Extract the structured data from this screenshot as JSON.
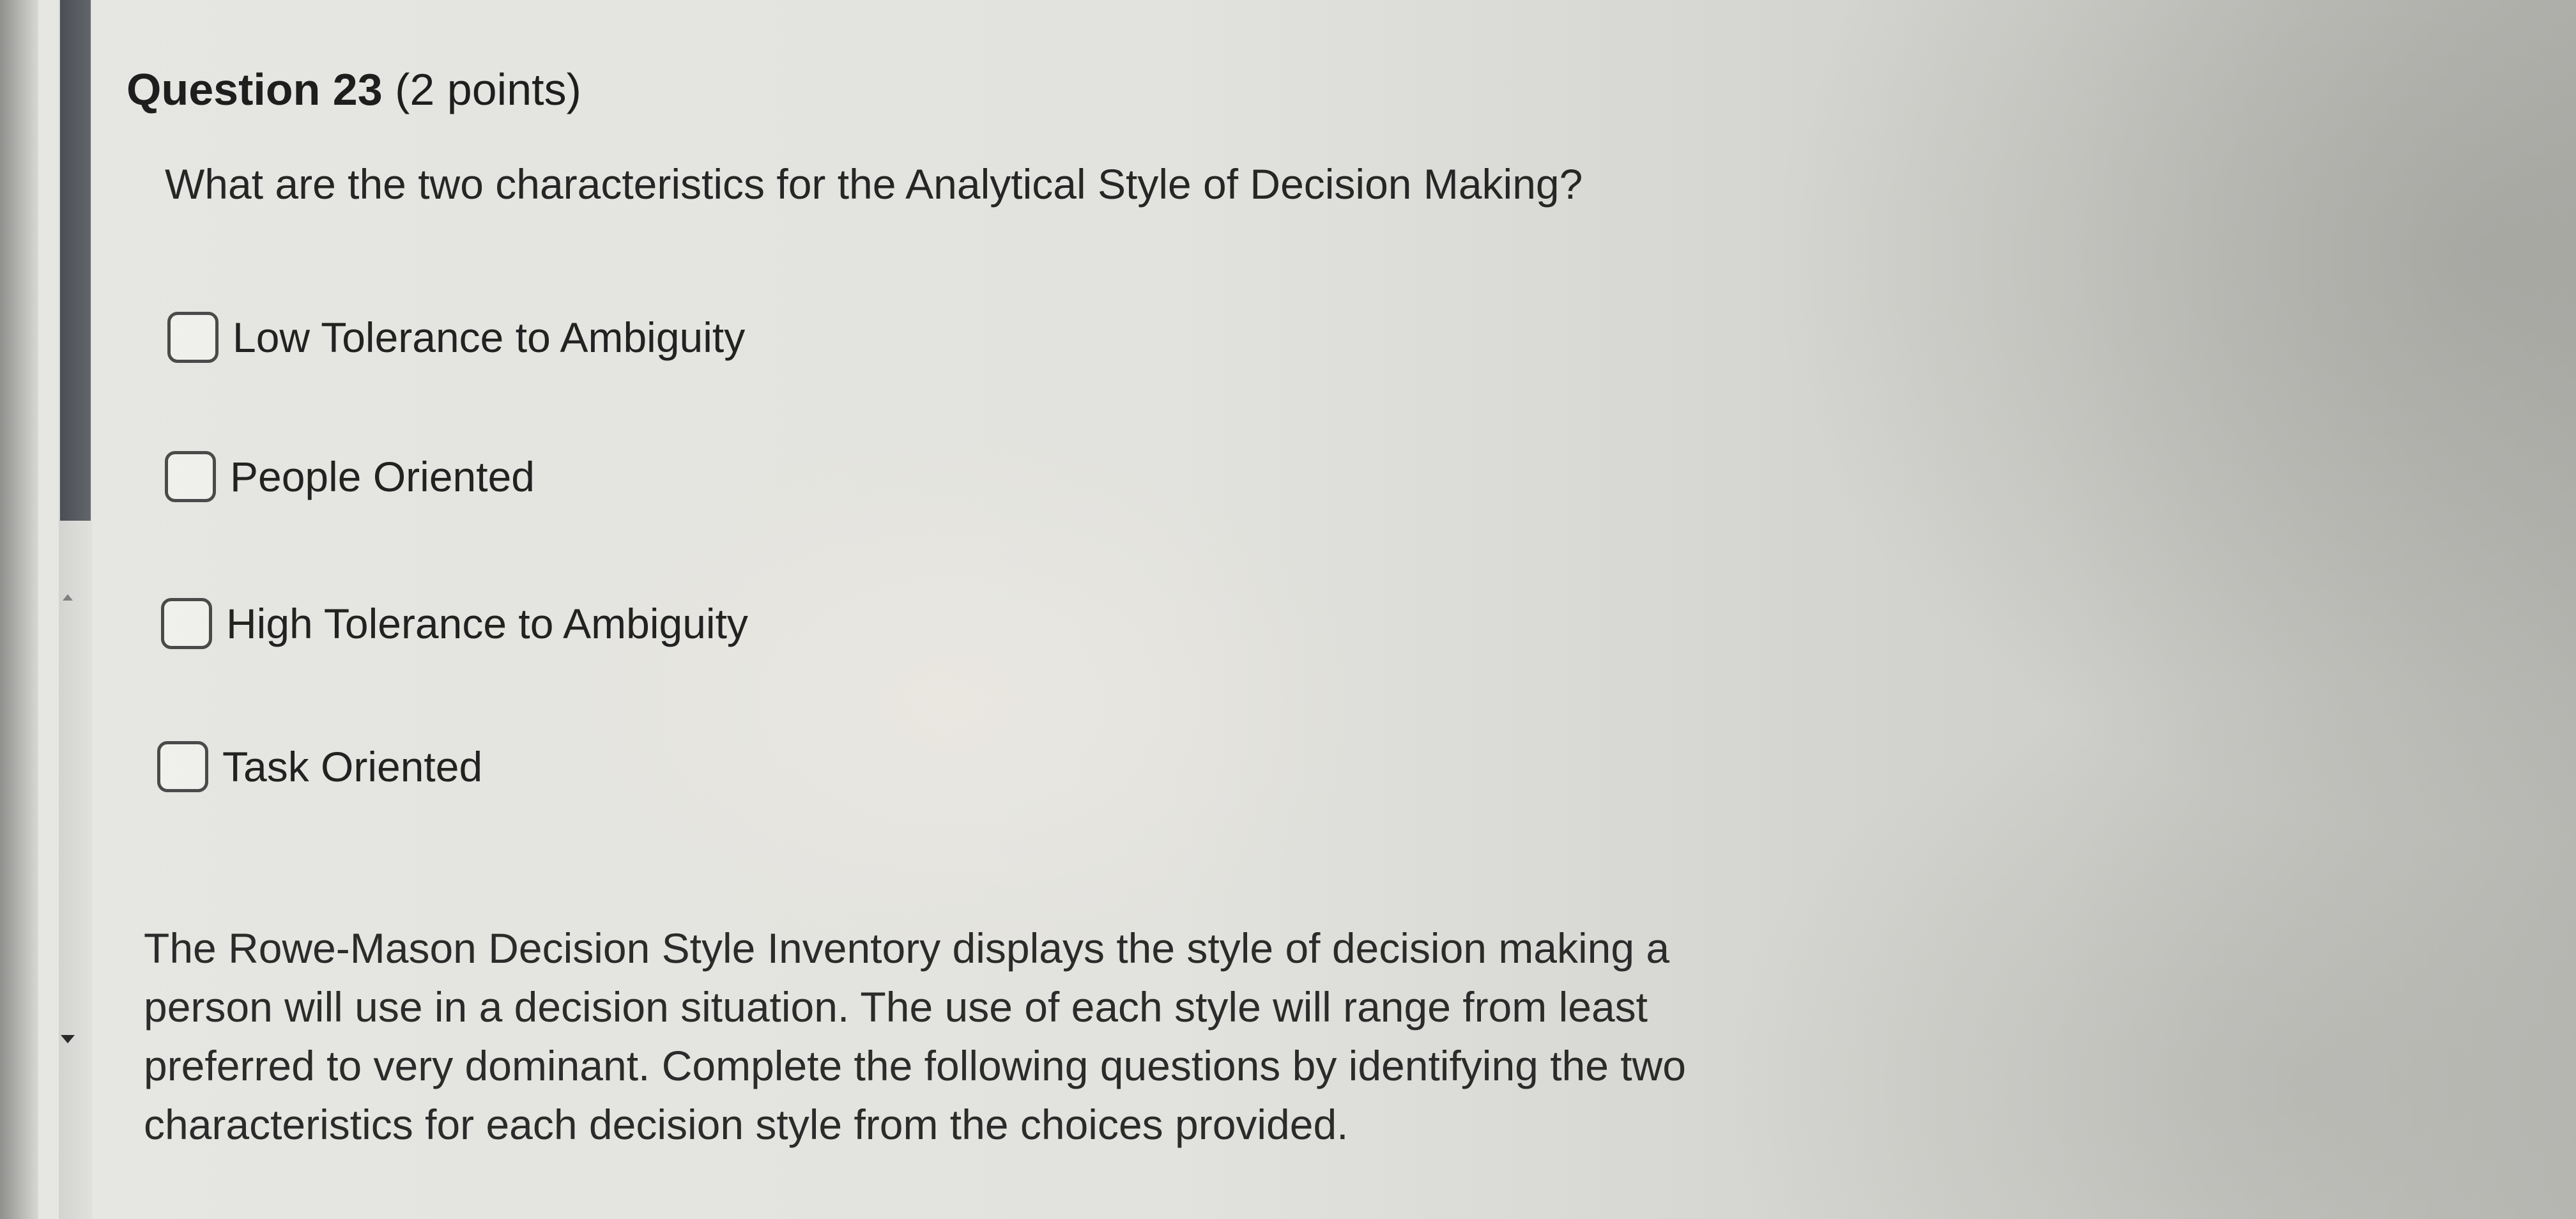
{
  "question": {
    "number_label": "Question 23",
    "points_label": "(2 points)",
    "text": "What are the two characteristics for the Analytical Style of Decision Making?"
  },
  "options": [
    {
      "label": "Low Tolerance to Ambiguity",
      "checked": false
    },
    {
      "label": "People Oriented",
      "checked": false
    },
    {
      "label": "High Tolerance to Ambiguity",
      "checked": false
    },
    {
      "label": "Task Oriented",
      "checked": false
    }
  ],
  "description": {
    "lines": [
      "The Rowe-Mason Decision Style Inventory displays the style of decision making a",
      "person will use in a decision situation. The use of each style will range from least",
      "preferred to very dominant. Complete the following questions by identifying the two",
      "characteristics for each decision style from the choices provided."
    ]
  },
  "colors": {
    "scrollbar_thumb": "#4b4f55",
    "text": "#2b2b2b"
  }
}
